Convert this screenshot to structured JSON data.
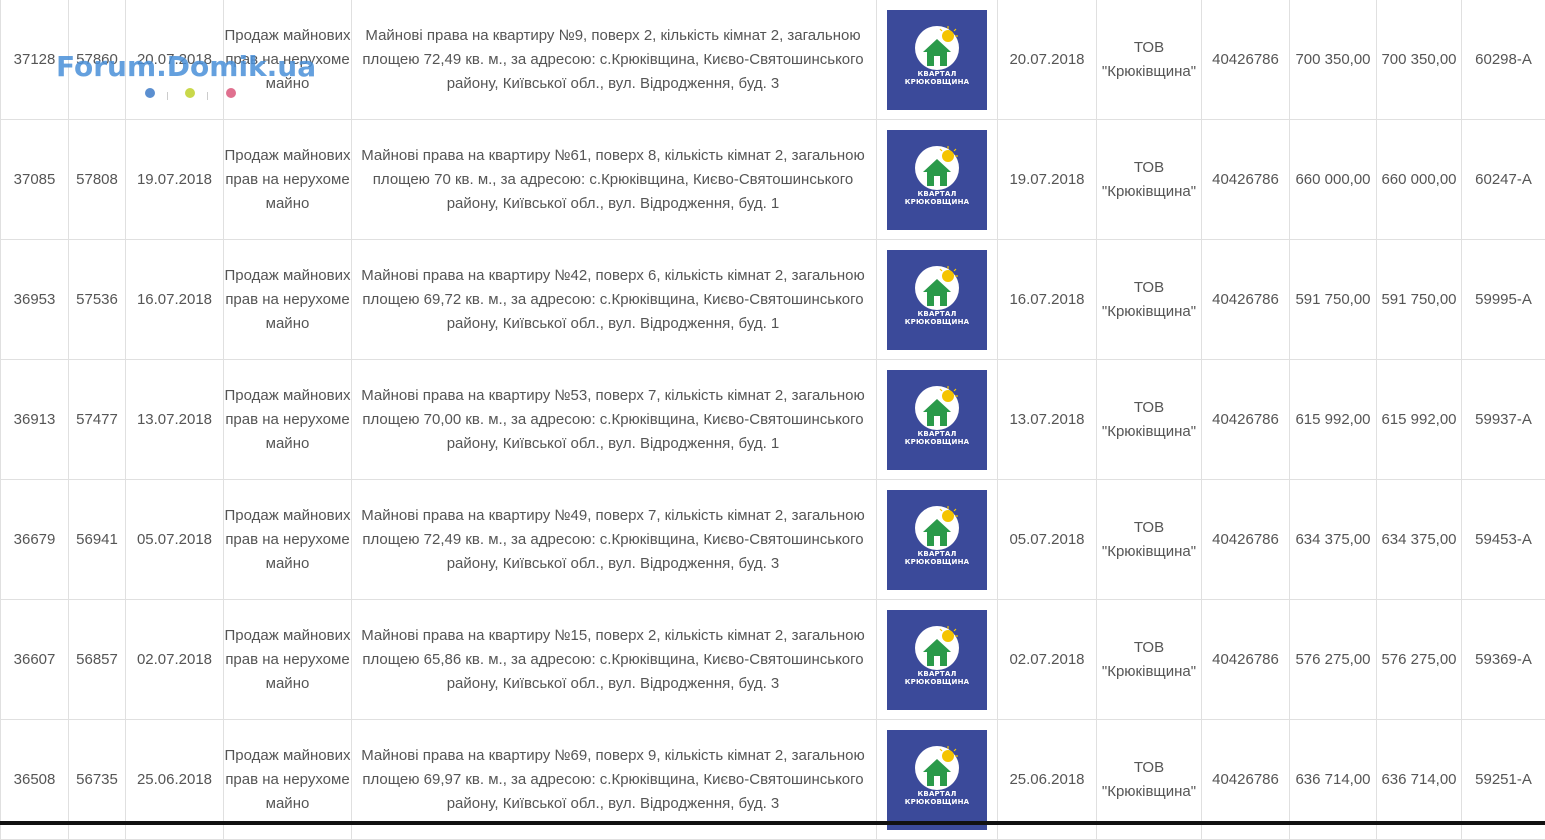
{
  "watermark": {
    "text": "Forum.Domik.ua",
    "dot_colors": [
      "#5b8fd0",
      "#c9d84a",
      "#e0708f"
    ]
  },
  "logo": {
    "line1": "КВАРТАЛ",
    "line2": "КРЮКОВЩИНА",
    "bg_color": "#3b4a9a"
  },
  "rows": [
    {
      "id": "37128",
      "num": "57860",
      "date": "20.07.2018",
      "type": "Продаж майнових прав на нерухоме майно",
      "desc": "Майнові права на квартиру №9, поверх 2, кількість кімнат 2, загальною площею 72,49 кв. м., за адресою: с.Крюківщина, Києво-Святошинського району, Київської обл., вул. Відродження, буд. 3",
      "date2": "20.07.2018",
      "company": "ТОВ \"Крюківщина\"",
      "code": "40426786",
      "amount1": "700 350,00",
      "amount2": "700 350,00",
      "ref": "60298-А"
    },
    {
      "id": "37085",
      "num": "57808",
      "date": "19.07.2018",
      "type": "Продаж майнових прав на нерухоме майно",
      "desc": "Майнові права на квартиру №61, поверх 8, кількість кімнат 2, загальною площею 70 кв. м., за адресою: с.Крюківщина, Києво-Святошинського району, Київської обл., вул. Відродження, буд. 1",
      "date2": "19.07.2018",
      "company": "ТОВ \"Крюківщина\"",
      "code": "40426786",
      "amount1": "660 000,00",
      "amount2": "660 000,00",
      "ref": "60247-А"
    },
    {
      "id": "36953",
      "num": "57536",
      "date": "16.07.2018",
      "type": "Продаж майнових прав на нерухоме майно",
      "desc": "Майнові права на квартиру №42, поверх 6, кількість кімнат 2, загальною площею 69,72 кв. м., за адресою: с.Крюківщина, Києво-Святошинського району, Київської обл., вул. Відродження, буд. 1",
      "date2": "16.07.2018",
      "company": "ТОВ \"Крюківщина\"",
      "code": "40426786",
      "amount1": "591 750,00",
      "amount2": "591 750,00",
      "ref": "59995-А"
    },
    {
      "id": "36913",
      "num": "57477",
      "date": "13.07.2018",
      "type": "Продаж майнових прав на нерухоме майно",
      "desc": "Майнові права на квартиру №53, поверх 7, кількість кімнат 2, загальною площею 70,00 кв. м., за адресою: с.Крюківщина, Києво-Святошинського району, Київської обл., вул. Відродження, буд. 1",
      "date2": "13.07.2018",
      "company": "ТОВ \"Крюківщина\"",
      "code": "40426786",
      "amount1": "615 992,00",
      "amount2": "615 992,00",
      "ref": "59937-А"
    },
    {
      "id": "36679",
      "num": "56941",
      "date": "05.07.2018",
      "type": "Продаж майнових прав на нерухоме майно",
      "desc": "Майнові права на квартиру №49, поверх 7, кількість кімнат 2, загальною площею 72,49 кв. м., за адресою: с.Крюківщина, Києво-Святошинського району, Київської обл., вул. Відродження, буд. 3",
      "date2": "05.07.2018",
      "company": "ТОВ \"Крюківщина\"",
      "code": "40426786",
      "amount1": "634 375,00",
      "amount2": "634 375,00",
      "ref": "59453-А"
    },
    {
      "id": "36607",
      "num": "56857",
      "date": "02.07.2018",
      "type": "Продаж майнових прав на нерухоме майно",
      "desc": "Майнові права на квартиру №15, поверх 2, кількість кімнат 2, загальною площею 65,86 кв. м., за адресою: с.Крюківщина, Києво-Святошинського району, Київської обл., вул. Відродження, буд. 3",
      "date2": "02.07.2018",
      "company": "ТОВ \"Крюківщина\"",
      "code": "40426786",
      "amount1": "576 275,00",
      "amount2": "576 275,00",
      "ref": "59369-А"
    },
    {
      "id": "36508",
      "num": "56735",
      "date": "25.06.2018",
      "type": "Продаж майнових прав на нерухоме майно",
      "desc": "Майнові права на квартиру №69, поверх 9, кількість кімнат 2, загальною площею 69,97 кв. м., за адресою: с.Крюківщина, Києво-Святошинського району, Київської обл., вул. Відродження, буд. 3",
      "date2": "25.06.2018",
      "company": "ТОВ \"Крюківщина\"",
      "code": "40426786",
      "amount1": "636 714,00",
      "amount2": "636 714,00",
      "ref": "59251-А"
    }
  ]
}
